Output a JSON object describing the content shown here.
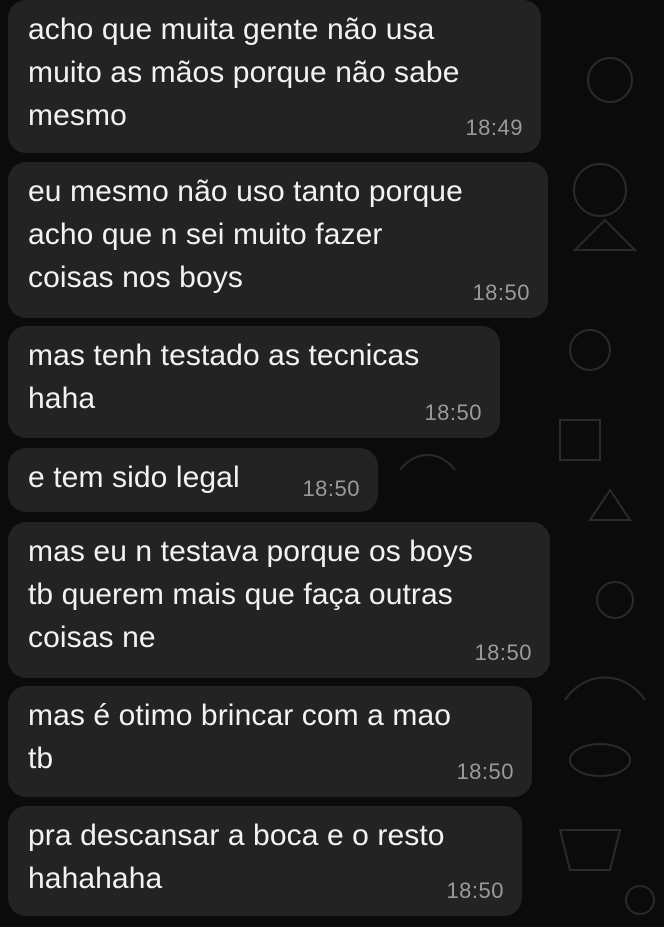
{
  "colors": {
    "background": "#0b0b0b",
    "bubble": "#232323",
    "text": "#f2f2f2",
    "time": "#9a9a9a"
  },
  "messages": [
    {
      "text": "acho que muita gente não usa\nmuito as mãos porque não sabe\nmesmo",
      "time": "18:49"
    },
    {
      "text": "eu mesmo não uso tanto porque\nacho que n sei muito fazer\ncoisas nos boys",
      "time": "18:50"
    },
    {
      "text": "mas tenh testado as tecnicas\nhaha",
      "time": "18:50"
    },
    {
      "text": "e tem sido legal",
      "time": "18:50"
    },
    {
      "text": "mas eu n testava porque os boys\ntb querem mais que faça outras\ncoisas ne",
      "time": "18:50"
    },
    {
      "text": "mas é otimo brincar com a mao\ntb",
      "time": "18:50"
    },
    {
      "text": "pra descansar a boca e o resto\nhahahaha",
      "time": "18:50"
    }
  ]
}
